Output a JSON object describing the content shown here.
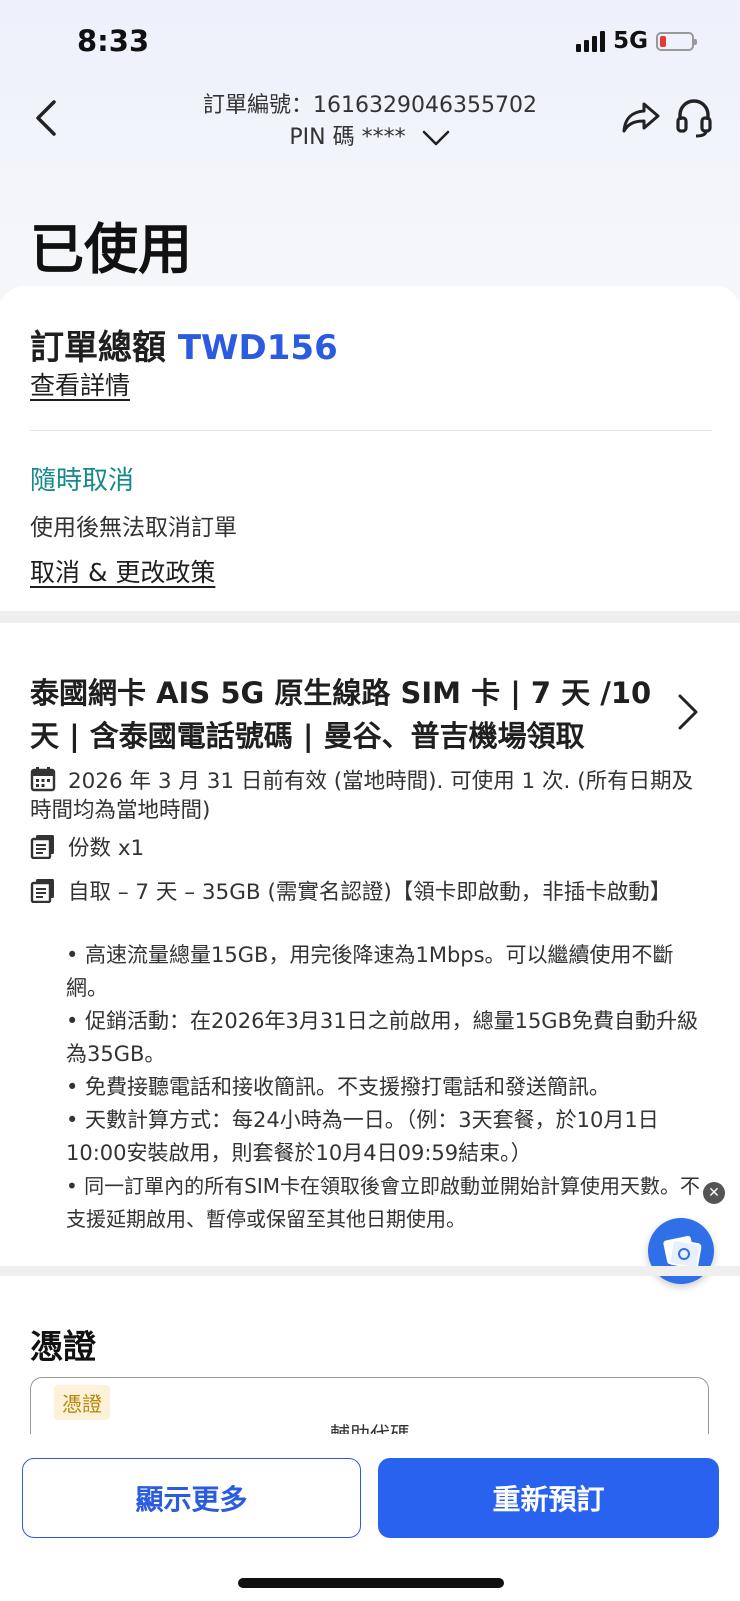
{
  "status_bar": {
    "time": "8:33",
    "network": "5G"
  },
  "header": {
    "order_number": "訂單編號：1616329046355702",
    "pin": "PIN 碼 ****"
  },
  "order_status": "已使用",
  "summary": {
    "total_label": "訂單總額",
    "total_amount": "TWD156",
    "view_details": "查看詳情"
  },
  "cancellation": {
    "title": "隨時取消",
    "note": "使用後無法取消訂單",
    "policy_link": "取消 & 更改政策"
  },
  "product": {
    "title": "泰國網卡 AIS 5G 原生線路 SIM 卡 | 7 天 /10 天 | 含泰國電話號碼 | 曼谷、普吉機場領取",
    "validity": "2026 年 3 月 31 日前有效 (當地時間). 可使用 1 次. (所有日期及時間均為當地時間)",
    "quantity": "份数 x1",
    "package": "自取 – 7 天 – 35GB (需實名認證)【領卡即啟動，非插卡啟動】",
    "bullets": [
      "• 高速流量總量15GB，用完後降速為1Mbps。可以繼續使用不斷網。",
      "• 促銷活動：在2026年3月31日之前啟用，總量15GB免費自動升級為35GB。",
      "• 免費接聽電話和接收簡訊。不支援撥打電話和發送簡訊。",
      "• 天數計算方式：每24小時為一日。（例：3天套餐，於10月1日10:00安裝啟用，則套餐於10月4日09:59結束。）",
      "• 同一訂單內的所有SIM卡在領取後會立即啟動並開始計算使用天數。不支援延期啟用、暫停或保留至其他日期使用。"
    ]
  },
  "voucher": {
    "title": "憑證",
    "badge": "憑證",
    "subtitle": "輔助代碼"
  },
  "actions": {
    "show_more": "顯示更多",
    "rebook": "重新預訂"
  },
  "colors": {
    "accent": "#2a5be0",
    "button_primary": "#2a62f0",
    "cancel_title": "#168a8a",
    "battery_low": "#e53935"
  }
}
